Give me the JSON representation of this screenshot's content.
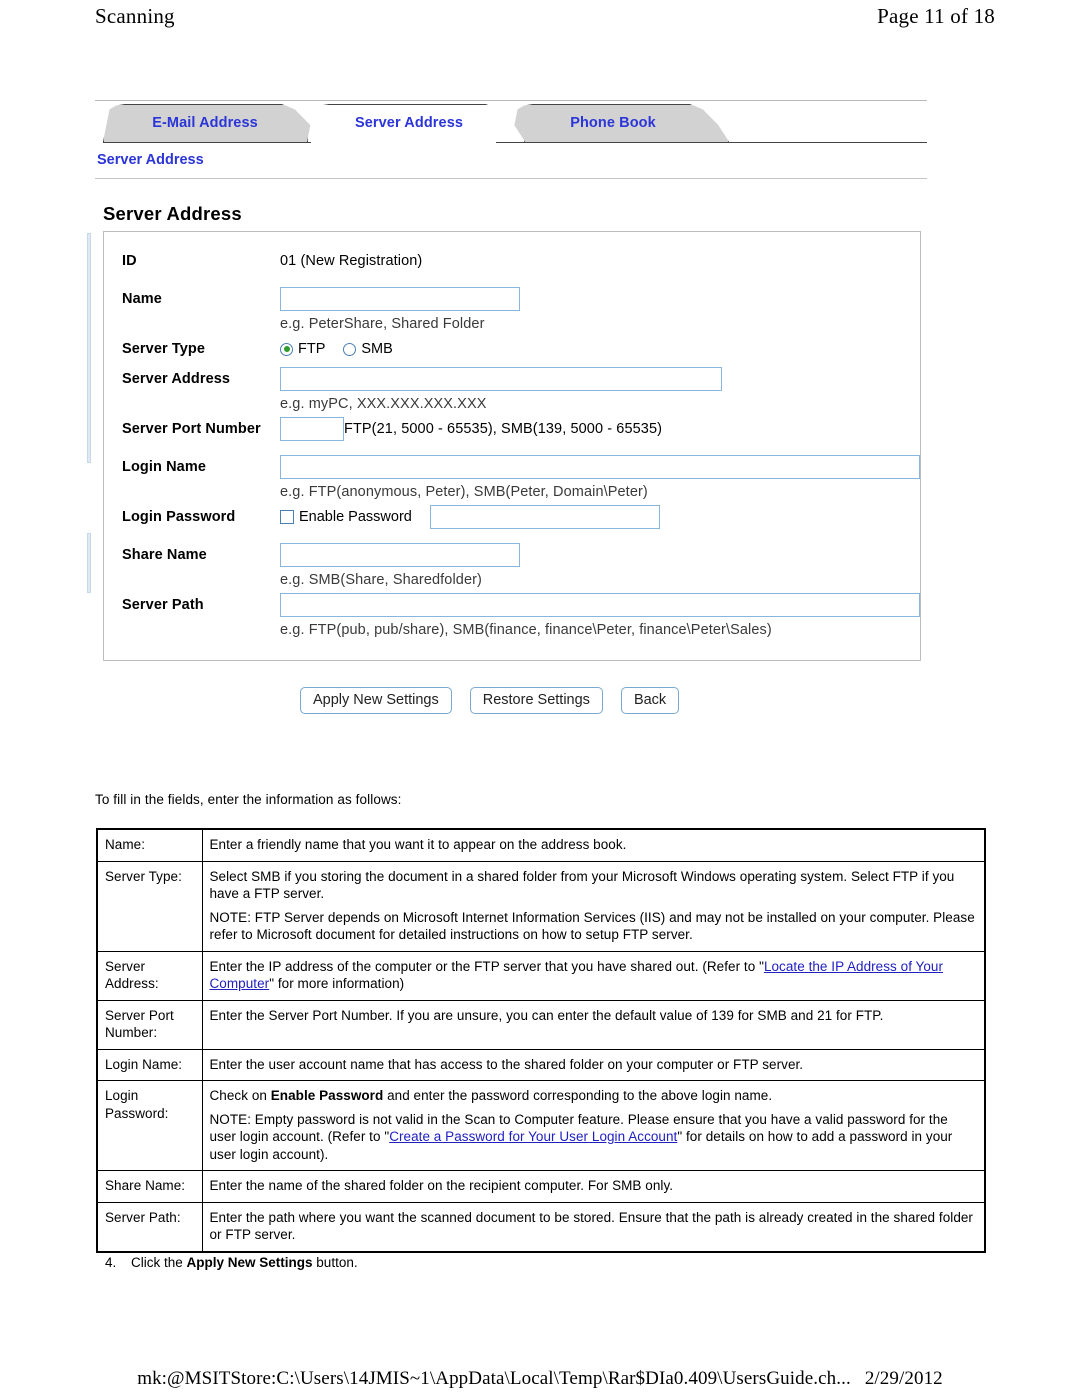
{
  "header": {
    "left": "Scanning",
    "right": "Page 11 of 18"
  },
  "tabs": [
    {
      "label": "E-Mail Address",
      "active": false
    },
    {
      "label": "Server Address",
      "active": true
    },
    {
      "label": "Phone Book",
      "active": false
    }
  ],
  "breadcrumb": "Server Address",
  "form": {
    "panel_title": "Server Address",
    "labels": {
      "id": "ID",
      "name": "Name",
      "server_type": "Server Type",
      "server_address": "Server Address",
      "server_port_number": "Server Port Number",
      "login_name": "Login Name",
      "login_password": "Login Password",
      "share_name": "Share Name",
      "server_path": "Server Path"
    },
    "values": {
      "id": "01 (New Registration)",
      "name": "",
      "server_address": "",
      "server_port_number": "",
      "login_name": "",
      "password": "",
      "share_name": "",
      "server_path": ""
    },
    "hints": {
      "name": "e.g. PeterShare, Shared Folder",
      "server_address": "e.g. myPC, XXX.XXX.XXX.XXX",
      "server_port_number": "FTP(21, 5000 - 65535), SMB(139, 5000 - 65535)",
      "login_name": "e.g. FTP(anonymous, Peter), SMB(Peter, Domain\\Peter)",
      "share_name": "e.g. SMB(Share, Sharedfolder)",
      "server_path": "e.g. FTP(pub, pub/share), SMB(finance, finance\\Peter, finance\\Peter\\Sales)"
    },
    "server_type": {
      "options": [
        "FTP",
        "SMB"
      ],
      "selected": "FTP"
    },
    "enable_password": {
      "label": "Enable Password",
      "checked": false
    }
  },
  "buttons": {
    "apply": "Apply New Settings",
    "restore": "Restore Settings",
    "back": "Back"
  },
  "body": {
    "intro": "To fill in the fields, enter the information as follows:",
    "step4_number": "4.",
    "step4_pre": "Click the ",
    "step4_bold": "Apply New Settings",
    "step4_post": " button."
  },
  "table": {
    "rows": [
      {
        "key": "Name:",
        "paras": [
          {
            "text": "Enter a friendly name that you want it to appear on the address book."
          }
        ]
      },
      {
        "key": "Server Type:",
        "paras": [
          {
            "text": "Select SMB if you storing the document in a shared folder from your Microsoft Windows operating system. Select FTP if you have a FTP server."
          },
          {
            "text": "NOTE: FTP Server depends on Microsoft Internet Information Services (IIS) and may not be installed on your computer. Please refer to Microsoft document for detailed instructions on how to setup FTP server."
          }
        ]
      },
      {
        "key": "Server Address:",
        "paras": [
          {
            "pre": "Enter the IP address of the computer or the FTP server that you have shared out. (Refer to \"",
            "link": "Locate the IP Address of Your Computer",
            "post": "\" for more information)"
          }
        ]
      },
      {
        "key": "Server Port Number:",
        "paras": [
          {
            "text": "Enter the Server Port Number. If you are unsure, you can enter the default value of 139 for SMB and 21 for FTP."
          }
        ]
      },
      {
        "key": "Login Name:",
        "paras": [
          {
            "text": "Enter the user account name that has access to the shared folder on your computer or FTP server."
          }
        ]
      },
      {
        "key": "Login Password:",
        "paras": [
          {
            "pre": "Check on ",
            "bold": "Enable Password",
            "post": " and enter the password corresponding to the above login name."
          },
          {
            "pre": "NOTE: Empty password is not valid in the Scan to Computer feature. Please ensure that you have a valid password for the user login account. (Refer to \"",
            "link": "Create a Password for Your User Login Account",
            "post": "\" for details on how to add a password in your user login account)."
          }
        ]
      },
      {
        "key": "Share Name:",
        "paras": [
          {
            "text": "Enter the name of the shared folder on the recipient computer. For SMB only."
          }
        ]
      },
      {
        "key": "Server Path:",
        "paras": [
          {
            "text": "Enter the path where you want the scanned document to be stored. Ensure that the path is already created in the shared folder or FTP server."
          }
        ]
      }
    ]
  },
  "footer": {
    "path": "mk:@MSITStore:C:\\Users\\14JMIS~1\\AppData\\Local\\Temp\\Rar$DIa0.409\\UsersGuide.ch...",
    "date": "2/29/2012"
  },
  "colors": {
    "tab_text": "#2b35d8",
    "link": "#2020c0",
    "input_border": "#8ab6dd",
    "radio_selected": "#2e9b2e"
  }
}
